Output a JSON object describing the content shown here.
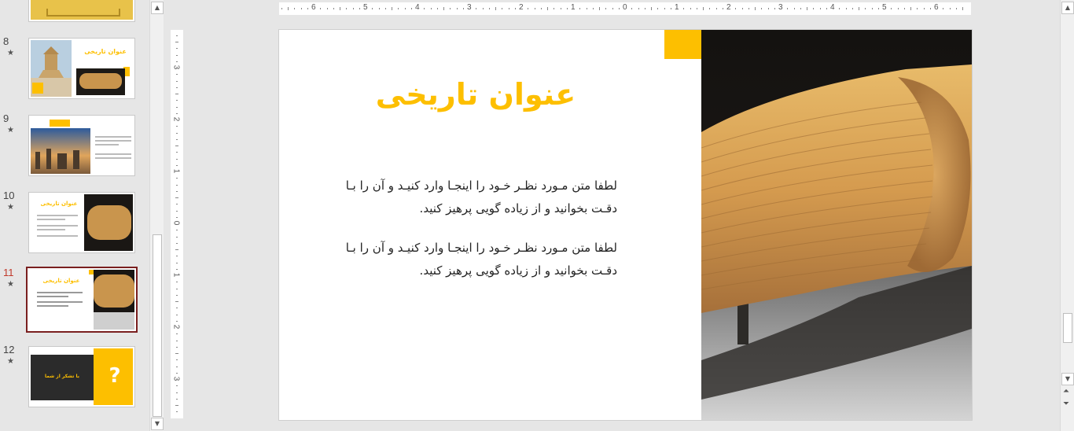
{
  "thumbnails": [
    {
      "num": "8",
      "star": "★",
      "title": "عنوان تاریخی"
    },
    {
      "num": "9",
      "star": "★"
    },
    {
      "num": "10",
      "star": "★",
      "title": "عنوان تاریخی"
    },
    {
      "num": "11",
      "star": "★",
      "title": "عنوان تاریخی"
    },
    {
      "num": "12",
      "star": "★",
      "thanks": "با تشکر از شما",
      "qmark": "?"
    }
  ],
  "ruler": {
    "h_labels": [
      "6",
      "5",
      "4",
      "3",
      "2",
      "1",
      "0",
      "1",
      "2",
      "3",
      "4",
      "5",
      "6"
    ],
    "v_labels": [
      "3",
      "2",
      "1",
      "0",
      "1",
      "2",
      "3"
    ]
  },
  "slide": {
    "title": "عنوان تاریخی",
    "paragraph1": "لطفا متن مـورد نظـر خـود را اینجـا وارد کنیـد و آن را بـا دقـت بخوانید و از زیاده گویی پرهیز کنید.",
    "paragraph2": "لطفا متن مـورد نظـر خـود را اینجـا وارد کنیـد و آن را بـا دقـت بخوانید و از زیاده گویی پرهیز کنید."
  },
  "icons": {
    "scroll_up": "chevron-up-icon",
    "scroll_down": "chevron-down-icon",
    "prev_slide": "double-chevron-up-icon",
    "next_slide": "double-chevron-down-icon"
  },
  "colors": {
    "accent": "#fdbf00",
    "selected_border": "#7a1f1f",
    "active_number": "#c0392b"
  }
}
